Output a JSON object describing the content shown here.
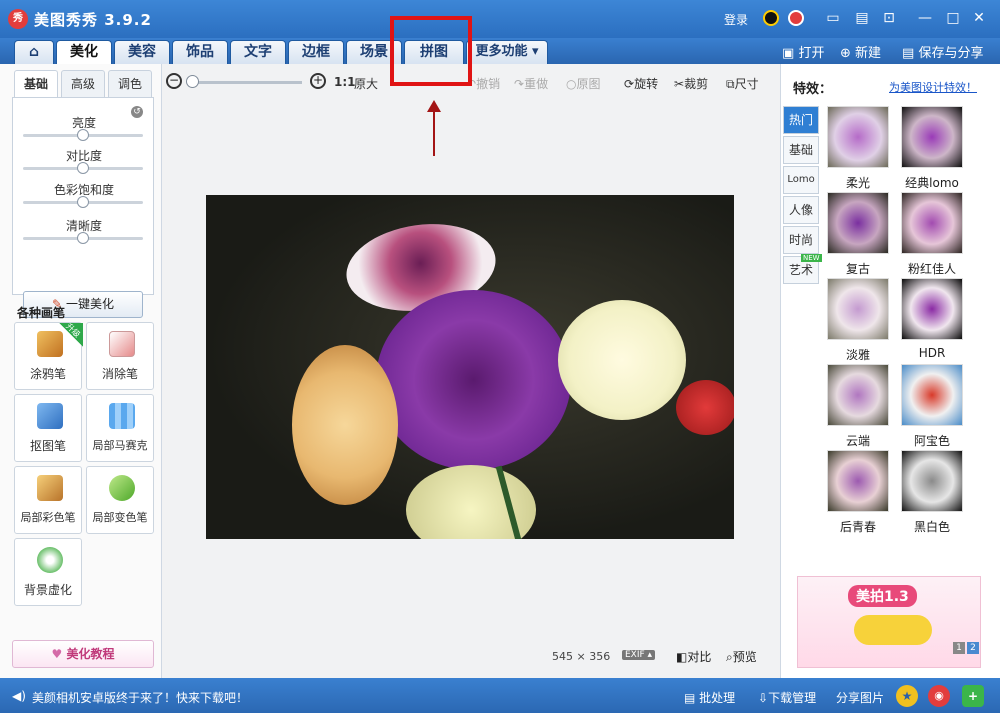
{
  "window": {
    "title": "美图秀秀 3.9.2",
    "logo_text": "秀",
    "login": "登录",
    "controls": [
      "▭",
      "▤",
      "⊡",
      "—",
      "✕"
    ]
  },
  "nav": {
    "home_icon": "home-icon",
    "tabs": [
      "美化",
      "美容",
      "饰品",
      "文字",
      "边框",
      "场景",
      "拼图",
      "更多功能 ▾"
    ],
    "active_tab": "美化",
    "open": "打开",
    "new": "新建",
    "save_share": "保存与分享"
  },
  "left": {
    "tabs": [
      "基础",
      "高级",
      "调色"
    ],
    "sliders": [
      {
        "label": "亮度",
        "value": 50
      },
      {
        "label": "对比度",
        "value": 50
      },
      {
        "label": "色彩饱和度",
        "value": 50
      },
      {
        "label": "清晰度",
        "value": 50
      }
    ],
    "onekey": "一键美化",
    "brushes_title": "各种画笔",
    "upgrade_badge": "升级",
    "brushes": [
      "涂鸦笔",
      "消除笔",
      "抠图笔",
      "局部马赛克",
      "局部彩色笔",
      "局部变色笔",
      "背景虚化"
    ],
    "tutorial": "美化教程"
  },
  "toolbar": {
    "ratio": "1:1",
    "original_size": "原大",
    "undo": "撤销",
    "redo": "重做",
    "original": "原图",
    "rotate": "旋转",
    "crop": "裁剪",
    "size": "尺寸"
  },
  "canvas": {
    "width": "545",
    "times": "×",
    "height": "356",
    "exif": "EXIF ▴",
    "compare": "对比",
    "preview": "预览"
  },
  "effects": {
    "title": "特效：",
    "link": "为美图设计特效！",
    "categories": [
      "热门",
      "基础",
      "Lomo",
      "人像",
      "时尚",
      "艺术"
    ],
    "new_badge": "NEW",
    "items": [
      "柔光",
      "经典lomo",
      "复古",
      "粉红佳人",
      "淡雅",
      "HDR",
      "云端",
      "阿宝色",
      "后青春",
      "黑白色"
    ],
    "ad_text": "美拍1.3",
    "pages": [
      "1",
      "2"
    ]
  },
  "status": {
    "message": "美颜相机安卓版终于来了！快来下载吧！",
    "batch": "批处理",
    "download": "下载管理",
    "share": "分享图片"
  },
  "colors": {
    "title_bar": "#2b6fc0",
    "highlight": "#e01414",
    "accent": "#2f7fd3"
  }
}
